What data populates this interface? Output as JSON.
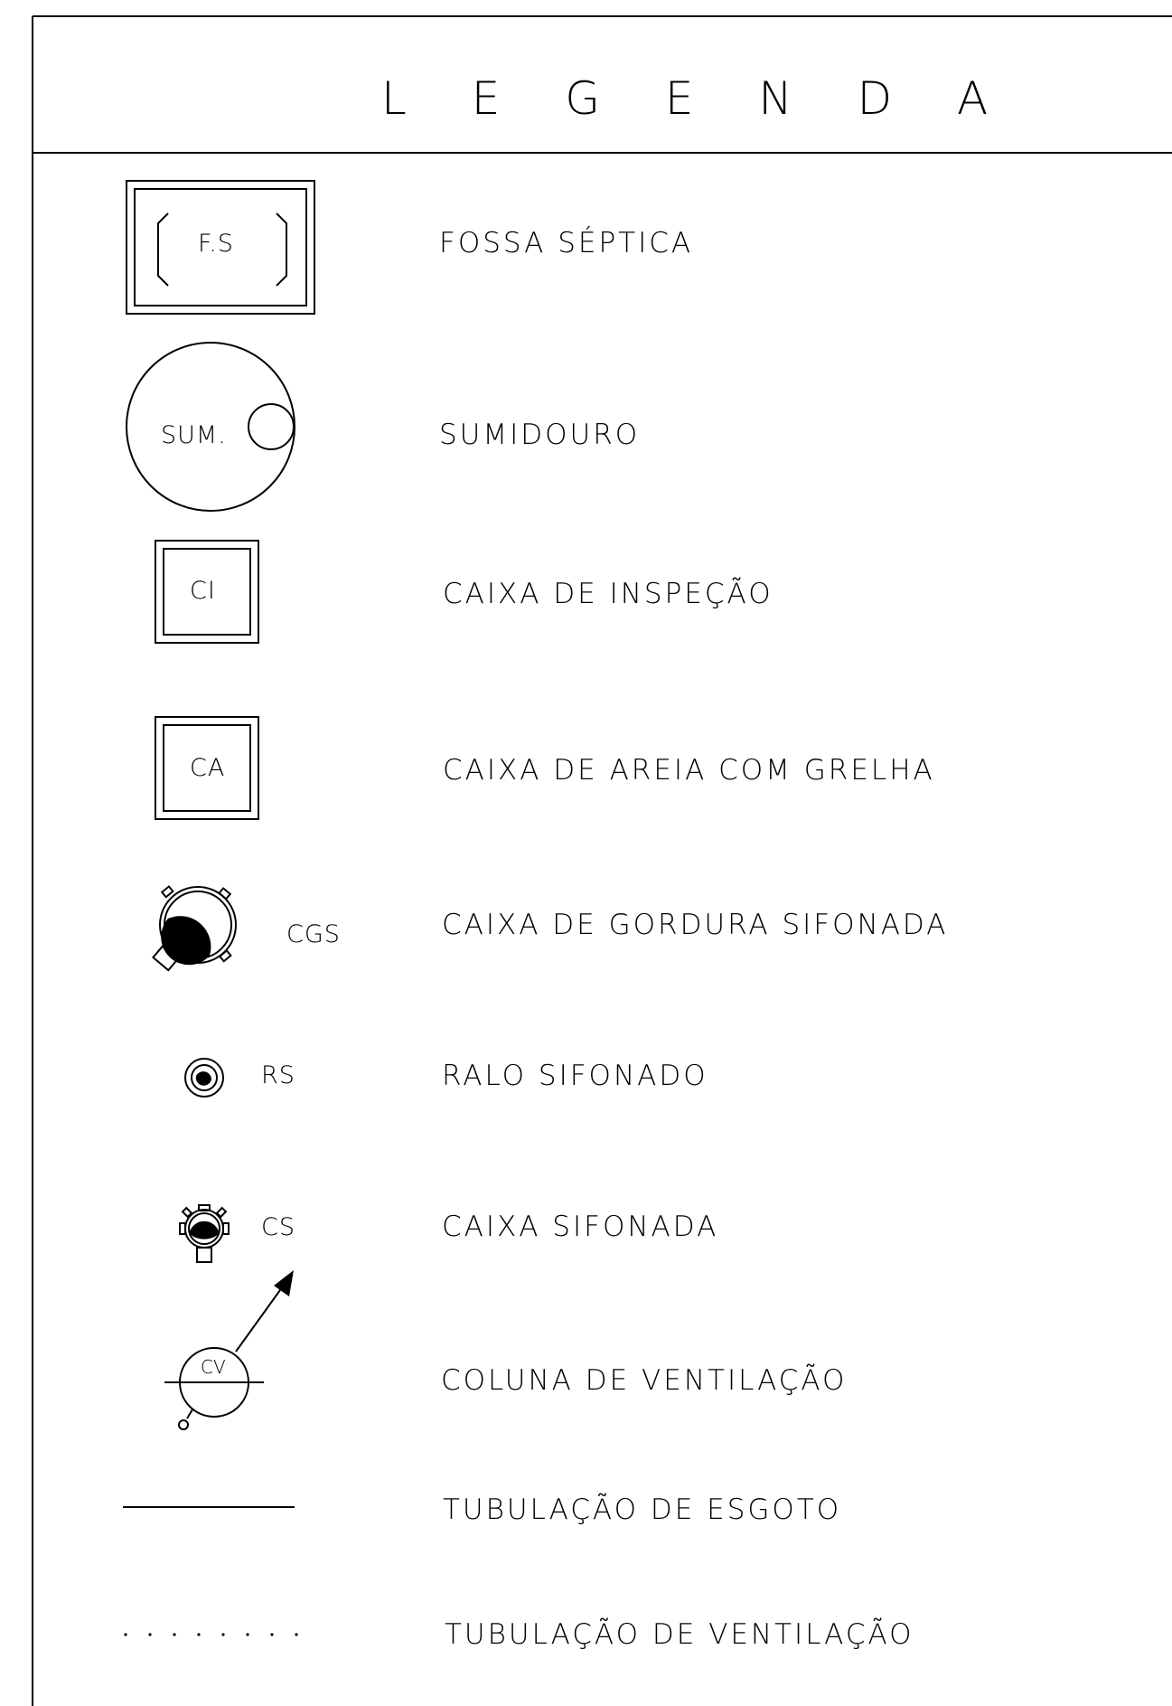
{
  "legend": {
    "title": "L E G E N D A",
    "items": [
      {
        "symbol": "fossa-septica",
        "symbol_text": "F.S",
        "label": "FOSSA SÉPTICA"
      },
      {
        "symbol": "sumidouro",
        "symbol_text": "SUM.",
        "label": "SUMIDOURO"
      },
      {
        "symbol": "caixa-inspecao",
        "symbol_text": "CI",
        "label": "CAIXA DE INSPEÇÃO"
      },
      {
        "symbol": "caixa-areia",
        "symbol_text": "CA",
        "label": "CAIXA DE AREIA COM GRELHA"
      },
      {
        "symbol": "caixa-gordura-sifonada",
        "symbol_text": "CGS",
        "label": "CAIXA DE GORDURA SIFONADA"
      },
      {
        "symbol": "ralo-sifonado",
        "symbol_text": "RS",
        "label": "RALO SIFONADO"
      },
      {
        "symbol": "caixa-sifonada",
        "symbol_text": "CS",
        "label": "CAIXA SIFONADA"
      },
      {
        "symbol": "coluna-ventilacao",
        "symbol_text": "CV",
        "label": "COLUNA DE VENTILAÇÃO"
      },
      {
        "symbol": "tubulacao-esgoto-line",
        "label": "TUBULAÇÃO DE ESGOTO"
      },
      {
        "symbol": "tubulacao-ventilacao-dotted-line",
        "label": "TUBULAÇÃO DE VENTILAÇÃO"
      }
    ]
  }
}
